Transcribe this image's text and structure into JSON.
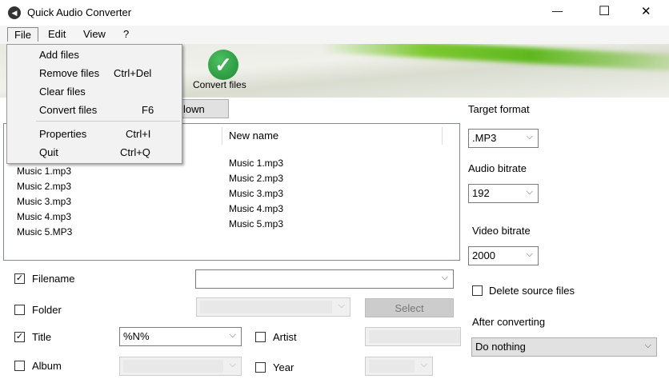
{
  "window": {
    "title": "Quick Audio Converter",
    "minimize": "—",
    "maximize": "☐",
    "close": "✕"
  },
  "menubar": [
    "File",
    "Edit",
    "View",
    "?"
  ],
  "file_menu": [
    {
      "label": "Add files",
      "shortcut": ""
    },
    {
      "label": "Remove files",
      "shortcut": "Ctrl+Del"
    },
    {
      "label": "Clear files",
      "shortcut": ""
    },
    {
      "label": "Convert files",
      "shortcut": "F6"
    },
    {
      "label": "Properties",
      "shortcut": "Ctrl+I"
    },
    {
      "label": "Quit",
      "shortcut": "Ctrl+Q"
    }
  ],
  "toolbar": {
    "convert_label": "Convert files",
    "down_button": "lown"
  },
  "list": {
    "col_new_name": "New name",
    "original": [
      "Music 1.mp3",
      "Music 2.mp3",
      "Music 3.mp3",
      "Music 4.mp3",
      "Music 5.MP3"
    ],
    "renamed": [
      "Music 1.mp3",
      "Music 2.mp3",
      "Music 3.mp3",
      "Music 4.mp3",
      "Music 5.mp3"
    ]
  },
  "options": {
    "filename": "Filename",
    "folder": "Folder",
    "select": "Select",
    "title": "Title",
    "title_value": "%N%",
    "artist": "Artist",
    "album": "Album",
    "year": "Year"
  },
  "right": {
    "target_format_label": "Target format",
    "target_format": ".MP3",
    "audio_bitrate_label": "Audio bitrate",
    "audio_bitrate": "192",
    "video_bitrate_label": "Video bitrate",
    "video_bitrate": "2000",
    "delete_source": "Delete source files",
    "after_label": "After converting",
    "after_value": "Do nothing"
  },
  "colors": {
    "accent": "#2ea043"
  }
}
